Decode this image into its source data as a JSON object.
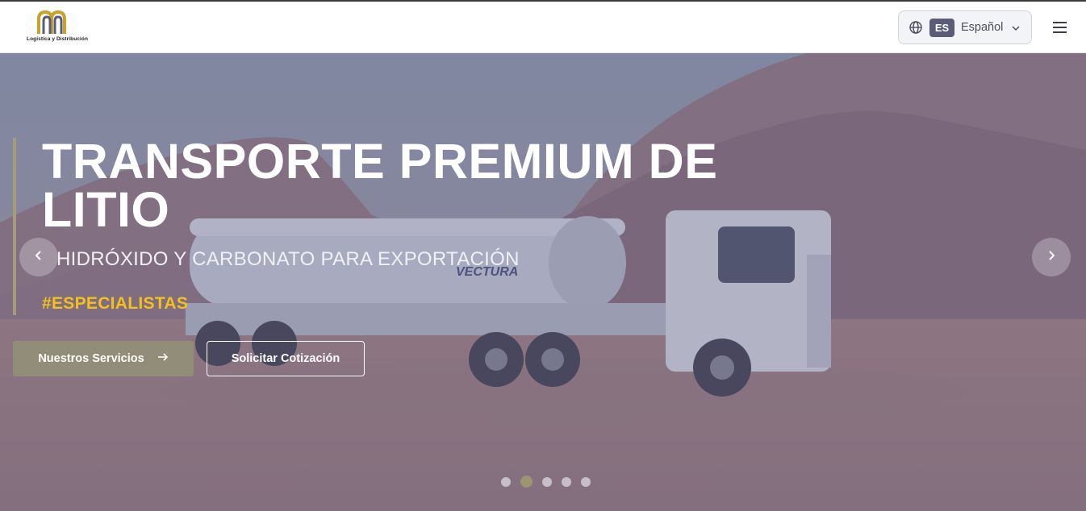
{
  "brand": {
    "logo_tagline": "Logística y Distribución"
  },
  "header": {
    "language": {
      "code": "ES",
      "name": "Español"
    }
  },
  "hero": {
    "title": "TRANSPORTE PREMIUM DE LITIO",
    "subtitle": "HIDRÓXIDO Y CARBONATO PARA EXPORTACIÓN",
    "tag": "#ESPECIALISTAS",
    "primary_button": "Nuestros Servicios",
    "secondary_button": "Solicitar Cotización",
    "truck_text": "VECTURA",
    "slides_total": 5,
    "active_slide": 2
  },
  "colors": {
    "accent": "#928d78",
    "tag_yellow": "#f2c11c",
    "language_badge": "#5b5c78",
    "logo_gold": "#c9a227",
    "logo_dark": "#5b5c78"
  }
}
